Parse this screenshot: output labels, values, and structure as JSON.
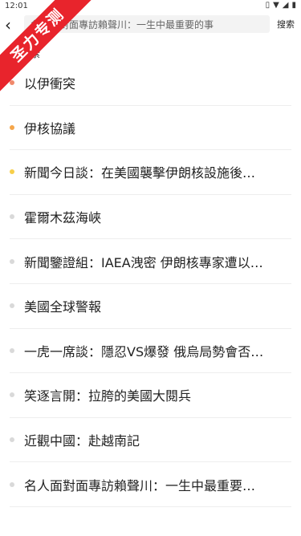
{
  "status_bar": {
    "time": "12:01",
    "icons": [
      "vibrate-icon",
      "wifi-icon",
      "signal-icon",
      "battery-icon"
    ]
  },
  "search": {
    "value": "名人面對面專訪賴聲川：一生中最重要的事",
    "button_label": "搜索"
  },
  "watermark": {
    "text": "圣力专测",
    "color": "#e8242c"
  },
  "section": {
    "label": "搜索"
  },
  "items": [
    {
      "label": "以伊衝突",
      "dot_color": "#f0896b"
    },
    {
      "label": "伊核協議",
      "dot_color": "#f5a64a"
    },
    {
      "label": "新聞今日談：在美國襲擊伊朗核設施後…",
      "dot_color": "#f7cf4a"
    },
    {
      "label": "霍爾木茲海峽",
      "dot_color": "#d9d9d9"
    },
    {
      "label": "新聞鑒證組：IAEA洩密 伊朗核專家遭以…",
      "dot_color": "#d9d9d9"
    },
    {
      "label": "美國全球警報",
      "dot_color": "#d9d9d9"
    },
    {
      "label": "一虎一席談：隱忍VS爆發 俄烏局勢會否…",
      "dot_color": "#d9d9d9"
    },
    {
      "label": "笑逐言開：拉胯的美國大閱兵",
      "dot_color": "#d9d9d9"
    },
    {
      "label": "近觀中國：赴越南記",
      "dot_color": "#d9d9d9"
    },
    {
      "label": "名人面對面專訪賴聲川：一生中最重要…",
      "dot_color": "#d9d9d9"
    }
  ]
}
